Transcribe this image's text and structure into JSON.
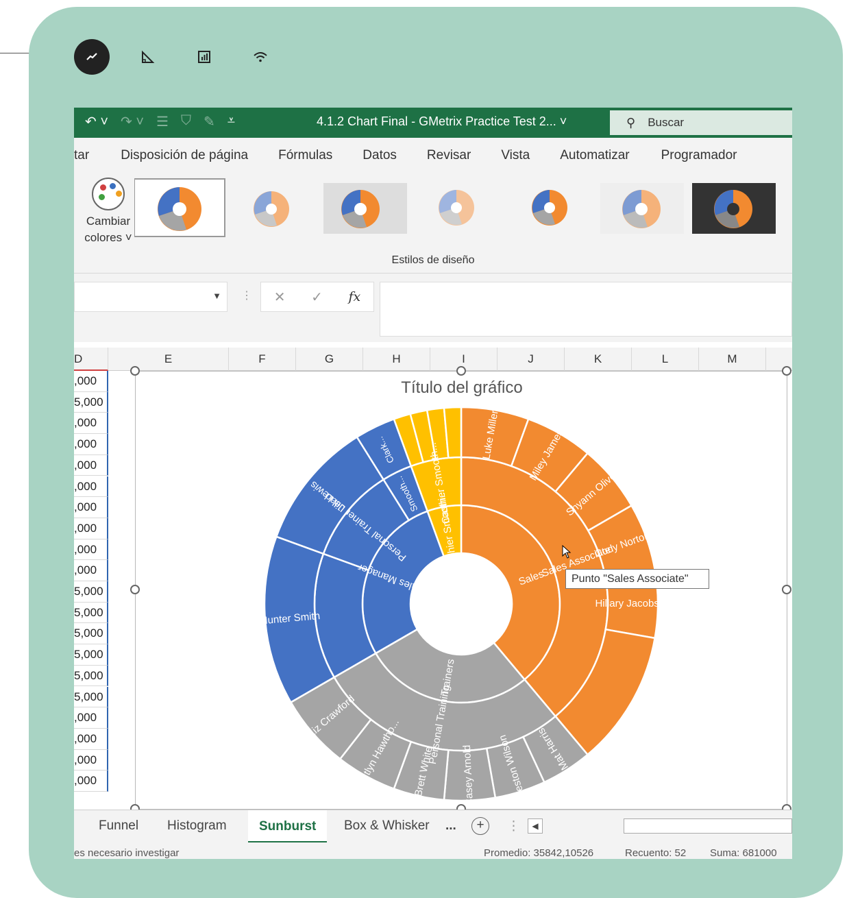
{
  "toolbar_icons": [
    "trend-chart-icon",
    "ruler-triangle-icon",
    "bar-chart-icon",
    "wifi-icon"
  ],
  "window": {
    "title": "4.1.2 Chart Final  -  GMetrix Practice Test 2...",
    "search_placeholder": "Buscar",
    "accent": "#1e7145"
  },
  "ribbon": {
    "tabs": [
      "tar",
      "Disposición de página",
      "Fórmulas",
      "Datos",
      "Revisar",
      "Vista",
      "Automatizar",
      "Programador"
    ],
    "change_colors_line1": "Cambiar",
    "change_colors_line2": "colores",
    "styles_group_label": "Estilos de diseño"
  },
  "columns": [
    "D",
    "E",
    "F",
    "G",
    "H",
    "I",
    "J",
    "K",
    "L",
    "M"
  ],
  "cell_values": [
    ",000",
    "5,000",
    ",000",
    ",000",
    ",000",
    ",000",
    ",000",
    ",000",
    ",000",
    ",000",
    "5,000",
    "5,000",
    "5,000",
    "5,000",
    "5,000",
    "5,000",
    ",000",
    ",000",
    ",000",
    ",000"
  ],
  "chart": {
    "title": "Título del gráfico",
    "tooltip": "Punto \"Sales Associate\""
  },
  "chart_data": {
    "type": "sunburst",
    "title": "Título del gráfico",
    "inner_ring": [
      {
        "label": "Sales",
        "color": "#f28a30",
        "start": 0,
        "end": 140
      },
      {
        "label": "Trainers",
        "color": "#a5a5a5",
        "start": 140,
        "end": 240
      },
      {
        "label": "Sales Manager",
        "color": "#4472c4",
        "start": 240,
        "end": 340
      },
      {
        "label": "Cashier Smooth...",
        "color": "#ffc000",
        "start": 340,
        "end": 360
      }
    ],
    "middle_ring": [
      {
        "label": "Sales Associate",
        "color": "#f28a30",
        "start": 0,
        "end": 140
      },
      {
        "label": "Personal Training",
        "color": "#a5a5a5",
        "start": 140,
        "end": 240
      },
      {
        "label": "Sales Manager",
        "color": "#4472c4",
        "start": 240,
        "end": 290
      },
      {
        "label": "Personal Trainer Lead",
        "color": "#4472c4",
        "start": 290,
        "end": 328
      },
      {
        "label": "Smooth...",
        "color": "#4472c4",
        "start": 328,
        "end": 340
      },
      {
        "label": "Cashier Smooth...",
        "color": "#ffc000",
        "start": 340,
        "end": 360
      }
    ],
    "outer_ring": [
      {
        "label": "Luke Miller",
        "color": "#f28a30",
        "start": 0,
        "end": 20
      },
      {
        "label": "Miley James",
        "color": "#f28a30",
        "start": 20,
        "end": 40
      },
      {
        "label": "Shyann Oliver",
        "color": "#f28a30",
        "start": 40,
        "end": 60
      },
      {
        "label": "Cody Norton",
        "color": "#f28a30",
        "start": 60,
        "end": 80
      },
      {
        "label": "Hillary Jacobson",
        "color": "#f28a30",
        "start": 80,
        "end": 100
      },
      {
        "label": "",
        "color": "#f28a30",
        "start": 100,
        "end": 140
      },
      {
        "label": "Mat Harris",
        "color": "#a5a5a5",
        "start": 140,
        "end": 155
      },
      {
        "label": "Weston Wilson",
        "color": "#a5a5a5",
        "start": 155,
        "end": 170
      },
      {
        "label": "Casey Arnold",
        "color": "#a5a5a5",
        "start": 170,
        "end": 185
      },
      {
        "label": "Brett White",
        "color": "#a5a5a5",
        "start": 185,
        "end": 200
      },
      {
        "label": "Caitlyn Hawtho...",
        "color": "#a5a5a5",
        "start": 200,
        "end": 218
      },
      {
        "label": "Liz Crawford",
        "color": "#a5a5a5",
        "start": 218,
        "end": 240
      },
      {
        "label": "Hunter Smith",
        "color": "#4472c4",
        "start": 240,
        "end": 290
      },
      {
        "label": "Jill Lewis",
        "color": "#4472c4",
        "start": 290,
        "end": 328
      },
      {
        "label": "Clark...",
        "color": "#4472c4",
        "start": 328,
        "end": 340
      },
      {
        "label": "",
        "color": "#ffc000",
        "start": 340,
        "end": 345
      },
      {
        "label": "",
        "color": "#ffc000",
        "start": 345,
        "end": 350
      },
      {
        "label": "",
        "color": "#ffc000",
        "start": 350,
        "end": 355
      },
      {
        "label": "",
        "color": "#ffc000",
        "start": 355,
        "end": 360
      }
    ]
  },
  "sheets": {
    "tabs": [
      "Funnel",
      "Histogram",
      "Sunburst",
      "Box & Whisker"
    ],
    "more": "...",
    "active": "Sunburst"
  },
  "status": {
    "message": "es necesario investigar",
    "average": "Promedio: 35842,10526",
    "count": "Recuento: 52",
    "sum": "Suma: 681000"
  }
}
